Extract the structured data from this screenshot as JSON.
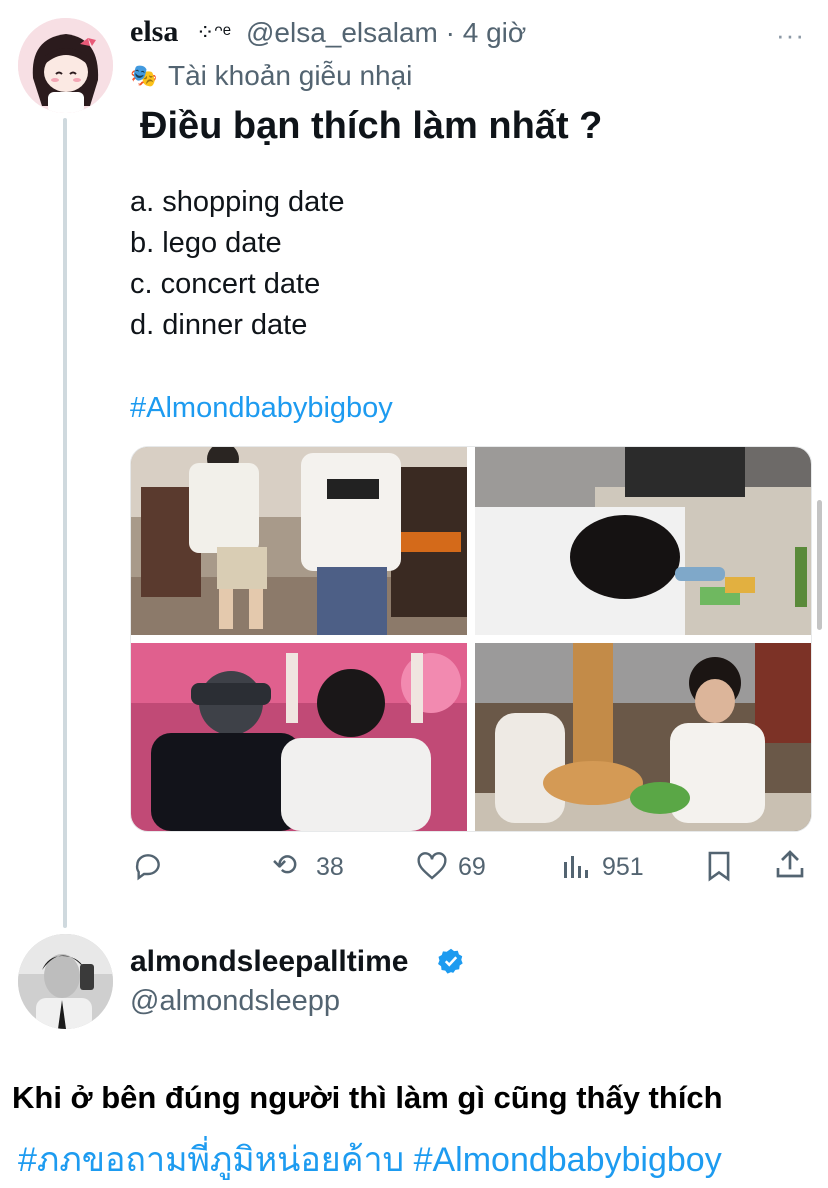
{
  "quoted_tweet": {
    "display_name": "elsa",
    "name_decoration": "⁘ᵔᵉ",
    "handle": "@elsa_elsalam",
    "separator": "·",
    "time": "4 giờ",
    "more_icon": "more-dots-icon",
    "more_glyph": "···",
    "parody_icon": "parody-mask-icon",
    "parody_glyph": "🎭",
    "parody_label": "Tài khoản giễu nhại",
    "question": "Điều bạn thích làm nhất ?",
    "options": [
      "a. shopping date",
      "b. lego date",
      "c. concert date",
      "d. dinner date"
    ],
    "hashtag": "#Almondbabybigboy",
    "photos": [
      "shopping",
      "lego",
      "concert",
      "dinner"
    ],
    "actions": {
      "reply_icon": "reply-icon",
      "retweet_icon": "retweet-icon",
      "retweet_glyph": "⟲",
      "retweets": "38",
      "like_icon": "heart-icon",
      "likes": "69",
      "views_icon": "views-chart-icon",
      "views": "951",
      "bookmark_icon": "bookmark-icon",
      "share_icon": "share-icon"
    }
  },
  "reply": {
    "display_name": "almondsleepalltime",
    "verified_icon": "verified-badge-icon",
    "handle": "@almondsleepp",
    "caption": "Khi ở bên đúng người thì làm gì cũng thấy thích",
    "hashtags": "#ภภขอถามพี่ภูมิหน่อยค้าบ #Almondbabybigboy"
  },
  "colors": {
    "link": "#1d9bf0",
    "secondary_text": "#536471",
    "verified": "#1d9bf0",
    "thread_line": "#cfd9de"
  }
}
